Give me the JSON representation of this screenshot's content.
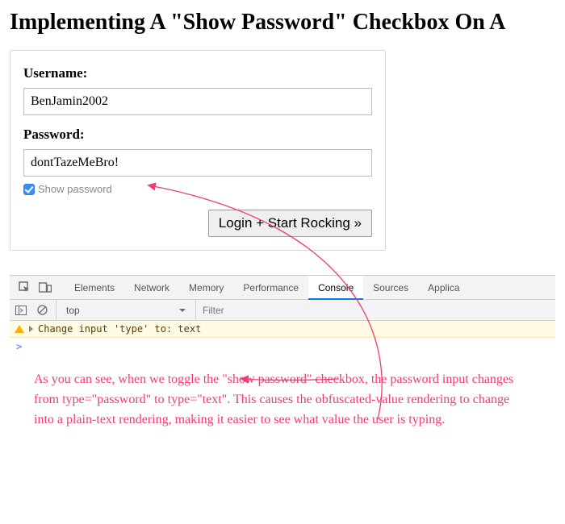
{
  "title": "Implementing A \"Show Password\" Checkbox On A",
  "form": {
    "username_label": "Username:",
    "username_value": "BenJamin2002",
    "password_label": "Password:",
    "password_value": "dontTazeMeBro!",
    "show_pw_label": "Show password",
    "submit_label": "Login + Start Rocking »"
  },
  "devtools": {
    "tabs": {
      "elements": "Elements",
      "network": "Network",
      "memory": "Memory",
      "performance": "Performance",
      "console": "Console",
      "sources": "Sources",
      "application": "Applica"
    },
    "context": "top",
    "filter_placeholder": "Filter",
    "log_message": "Change input 'type' to: text",
    "prompt": ">"
  },
  "annotation": "As you can see, when we toggle the \"show password\" checkbox, the password input changes from type=\"password\" to type=\"text\". This causes the obfuscated-value rendering to change into a plain-text rendering, making it easier to see what value the user is typing."
}
